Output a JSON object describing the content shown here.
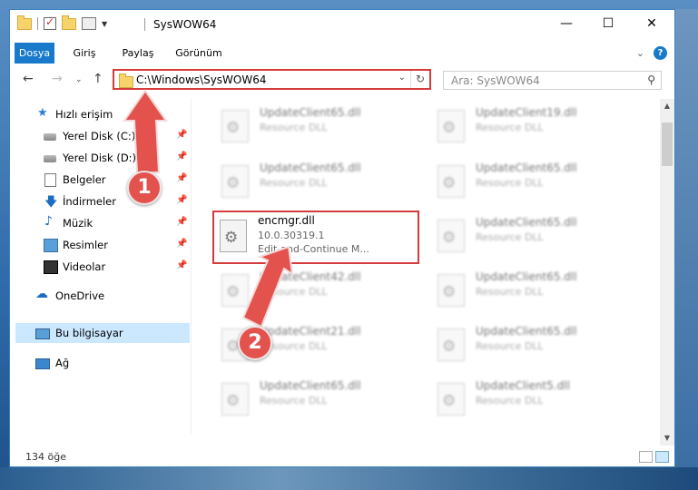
{
  "window": {
    "title": "SysWOW64"
  },
  "ribbon": {
    "tabs": [
      "Dosya",
      "Giriş",
      "Paylaş",
      "Görünüm"
    ],
    "active_tab": "Dosya"
  },
  "address": {
    "path": "C:\\Windows\\SysWOW64"
  },
  "search": {
    "placeholder": "Ara: SysWOW64"
  },
  "sidebar": {
    "items": [
      {
        "label": "Hızlı erişim",
        "icon": "star-icon"
      },
      {
        "label": "Yerel Disk (C:)",
        "icon": "disk-icon"
      },
      {
        "label": "Yerel Disk (D:)",
        "icon": "disk-icon"
      },
      {
        "label": "Belgeler",
        "icon": "documents-icon"
      },
      {
        "label": "İndirmeler",
        "icon": "download-icon"
      },
      {
        "label": "Müzik",
        "icon": "music-icon"
      },
      {
        "label": "Resimler",
        "icon": "pictures-icon"
      },
      {
        "label": "Videolar",
        "icon": "video-icon"
      },
      {
        "label": "OneDrive",
        "icon": "cloud-icon"
      },
      {
        "label": "Bu bilgisayar",
        "icon": "computer-icon"
      },
      {
        "label": "Ağ",
        "icon": "network-icon"
      }
    ]
  },
  "files": {
    "left": [
      {
        "name": "UpdateClient65.dll",
        "desc": "Resource DLL"
      },
      {
        "name": "UpdateClient65.dll",
        "desc": "Resource DLL"
      },
      {
        "name": "encmgr.dll",
        "desc": "10.0.30319.1",
        "desc2": "Edit-and-Continue M..."
      },
      {
        "name": "UpdateClient42.dll",
        "desc": "Resource DLL"
      },
      {
        "name": "UpdateClient21.dll",
        "desc": "Resource DLL"
      },
      {
        "name": "UpdateClient65.dll",
        "desc": "Resource DLL"
      }
    ],
    "right": [
      {
        "name": "UpdateClient19.dll",
        "desc": "Resource DLL"
      },
      {
        "name": "UpdateClient65.dll",
        "desc": "Resource DLL"
      },
      {
        "name": "UpdateClient65.dll",
        "desc": "Resource DLL"
      },
      {
        "name": "UpdateClient65.dll",
        "desc": "Resource DLL"
      },
      {
        "name": "UpdateClient65.dll",
        "desc": "Resource DLL"
      },
      {
        "name": "UpdateClient5.dll",
        "desc": "Resource DLL"
      }
    ]
  },
  "status": {
    "item_count": "134 öğe"
  },
  "annotations": {
    "step1": "1",
    "step2": "2"
  },
  "colors": {
    "accent": "#1979ca",
    "highlight": "#d53b3b",
    "badge": "#e4524e"
  }
}
